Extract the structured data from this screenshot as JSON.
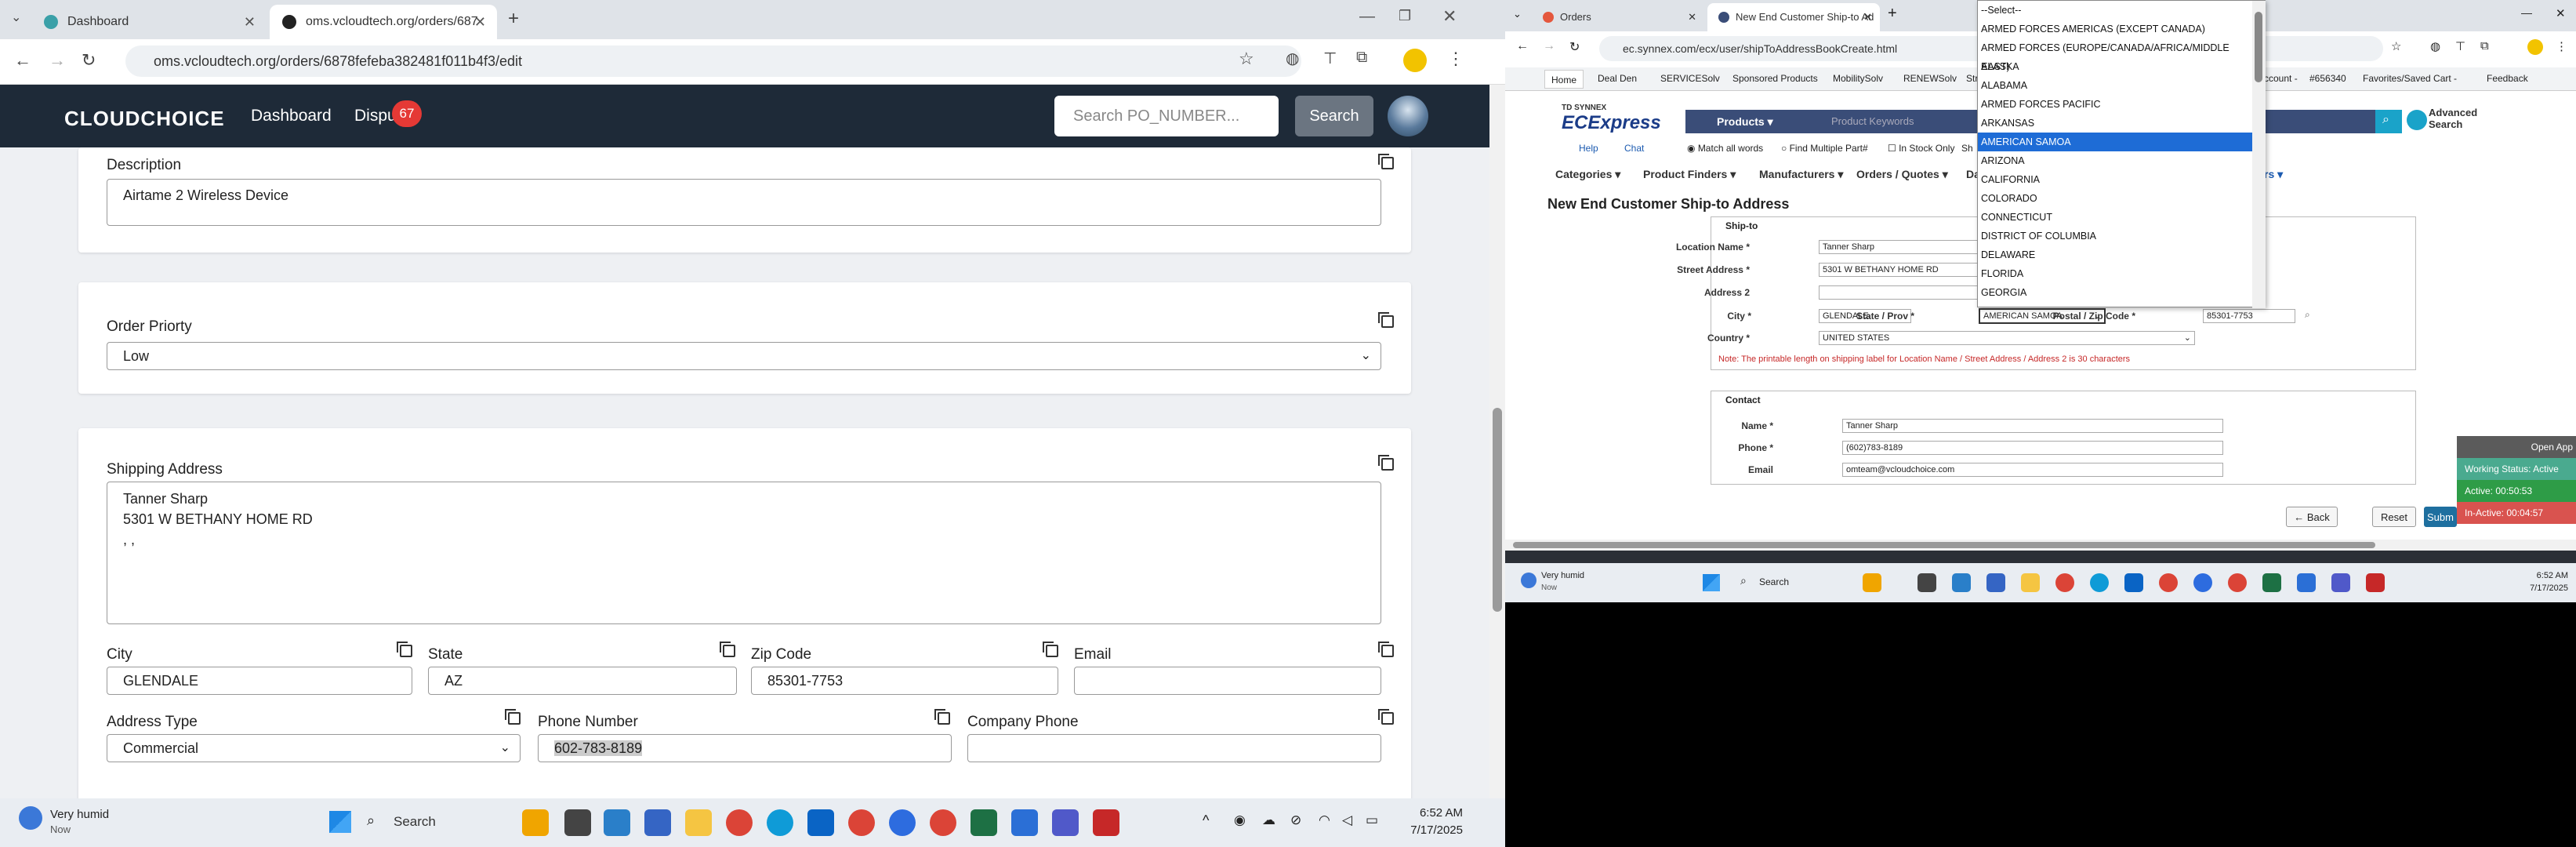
{
  "left": {
    "tabs": [
      {
        "title": "Dashboard"
      },
      {
        "title": "oms.vcloudtech.org/orders/687"
      }
    ],
    "url": "oms.vcloudtech.org/orders/6878fefeba382481f011b4f3/edit",
    "brand": "CLOUDCHOICE",
    "nav": {
      "dashboard": "Dashboard",
      "disputes": "Dispu",
      "badge": "67"
    },
    "search": {
      "placeholder": "Search PO_NUMBER...",
      "button": "Search"
    },
    "form": {
      "description_label": "Description",
      "description": "Airtame 2 Wireless Device",
      "priority_label": "Order Priorty",
      "priority": "Low",
      "shipping_label": "Shipping Address",
      "shipping_line1": "Tanner Sharp",
      "shipping_line2": "5301 W BETHANY HOME RD",
      "shipping_line3": ", ,",
      "city_label": "City",
      "city": "GLENDALE",
      "state_label": "State",
      "state": "AZ",
      "zip_label": "Zip Code",
      "zip": "85301-7753",
      "email_label": "Email",
      "email": "",
      "addrtype_label": "Address Type",
      "addrtype": "Commercial",
      "phone_label": "Phone Number",
      "phone": "602-783-8189",
      "company_phone_label": "Company Phone",
      "company_phone": ""
    },
    "taskbar": {
      "weather": "Very humid",
      "weather_sub": "Now",
      "search": "Search",
      "time": "6:52 AM",
      "date": "7/17/2025"
    }
  },
  "right": {
    "tabs": [
      {
        "title": "Orders"
      },
      {
        "title": "New End Customer Ship-to Ad"
      }
    ],
    "url": "ec.synnex.com/ecx/user/shipToAddressBookCreate.html",
    "bookmarks": [
      "Home",
      "Deal Den",
      "SERVICESolv",
      "Sponsored Products",
      "MobilitySolv",
      "RENEWSolv",
      "Strea"
    ],
    "bookmarks_right": [
      "ccount -",
      "#656340",
      "Favorites/Saved Cart -",
      "Feedback"
    ],
    "brand_top": "TD SYNNEX",
    "brand": "ECExpress",
    "products": "Products",
    "keywords": "Product Keywords",
    "advanced": "Advanced Search",
    "options": {
      "help": "Help",
      "chat": "Chat",
      "match": "Match all words",
      "find": "Find Multiple Part#",
      "stock": "In Stock Only",
      "sh": "Sh"
    },
    "menu": [
      "Categories",
      "Product Finders",
      "Manufacturers",
      "Orders / Quotes",
      "Da",
      "rs"
    ],
    "page_title": "New End Customer Ship-to Address",
    "shipto": {
      "section": "Ship-to",
      "location_label": "Location Name *",
      "location": "Tanner Sharp",
      "street_label": "Street Address *",
      "street": "5301 W BETHANY HOME RD",
      "address2_label": "Address 2",
      "address2": "",
      "city_label": "City *",
      "city": "GLENDALE",
      "state_label": "State / Prov *",
      "state": "AMERICAN SAMOA",
      "zip_label": "Postal / Zip Code *",
      "zip": "85301-7753",
      "country_label": "Country *",
      "country": "UNITED STATES",
      "note": "Note: The printable length on shipping label for Location Name / Street Address / Address 2 is 30 characters"
    },
    "contact": {
      "section": "Contact",
      "name_label": "Name *",
      "name": "Tanner Sharp",
      "phone_label": "Phone *",
      "phone": "(602)783-8189",
      "email_label": "Email",
      "email": "omteam@vcloudchoice.com"
    },
    "buttons": {
      "back": "Back",
      "reset": "Reset",
      "submit": "Subm"
    },
    "dropdown": [
      "--Select--",
      "ARMED FORCES AMERICAS (EXCEPT CANADA)",
      "ARMED FORCES (EUROPE/CANADA/AFRICA/MIDDLE EAST)",
      "ALASKA",
      "ALABAMA",
      "ARMED FORCES PACIFIC",
      "ARKANSAS",
      "AMERICAN SAMOA",
      "ARIZONA",
      "CALIFORNIA",
      "COLORADO",
      "CONNECTICUT",
      "DISTRICT OF COLUMBIA",
      "DELAWARE",
      "FLORIDA",
      "GEORGIA"
    ],
    "dropdown_selected": "AMERICAN SAMOA",
    "status": {
      "open": "Open App",
      "working": "Working Status: Active",
      "active": "Active: 00:50:53",
      "inactive": "In-Active: 00:04:57"
    },
    "taskbar": {
      "weather": "Very humid",
      "weather_sub": "Now",
      "search": "Search",
      "time": "6:52 AM",
      "date": "7/17/2025"
    }
  }
}
